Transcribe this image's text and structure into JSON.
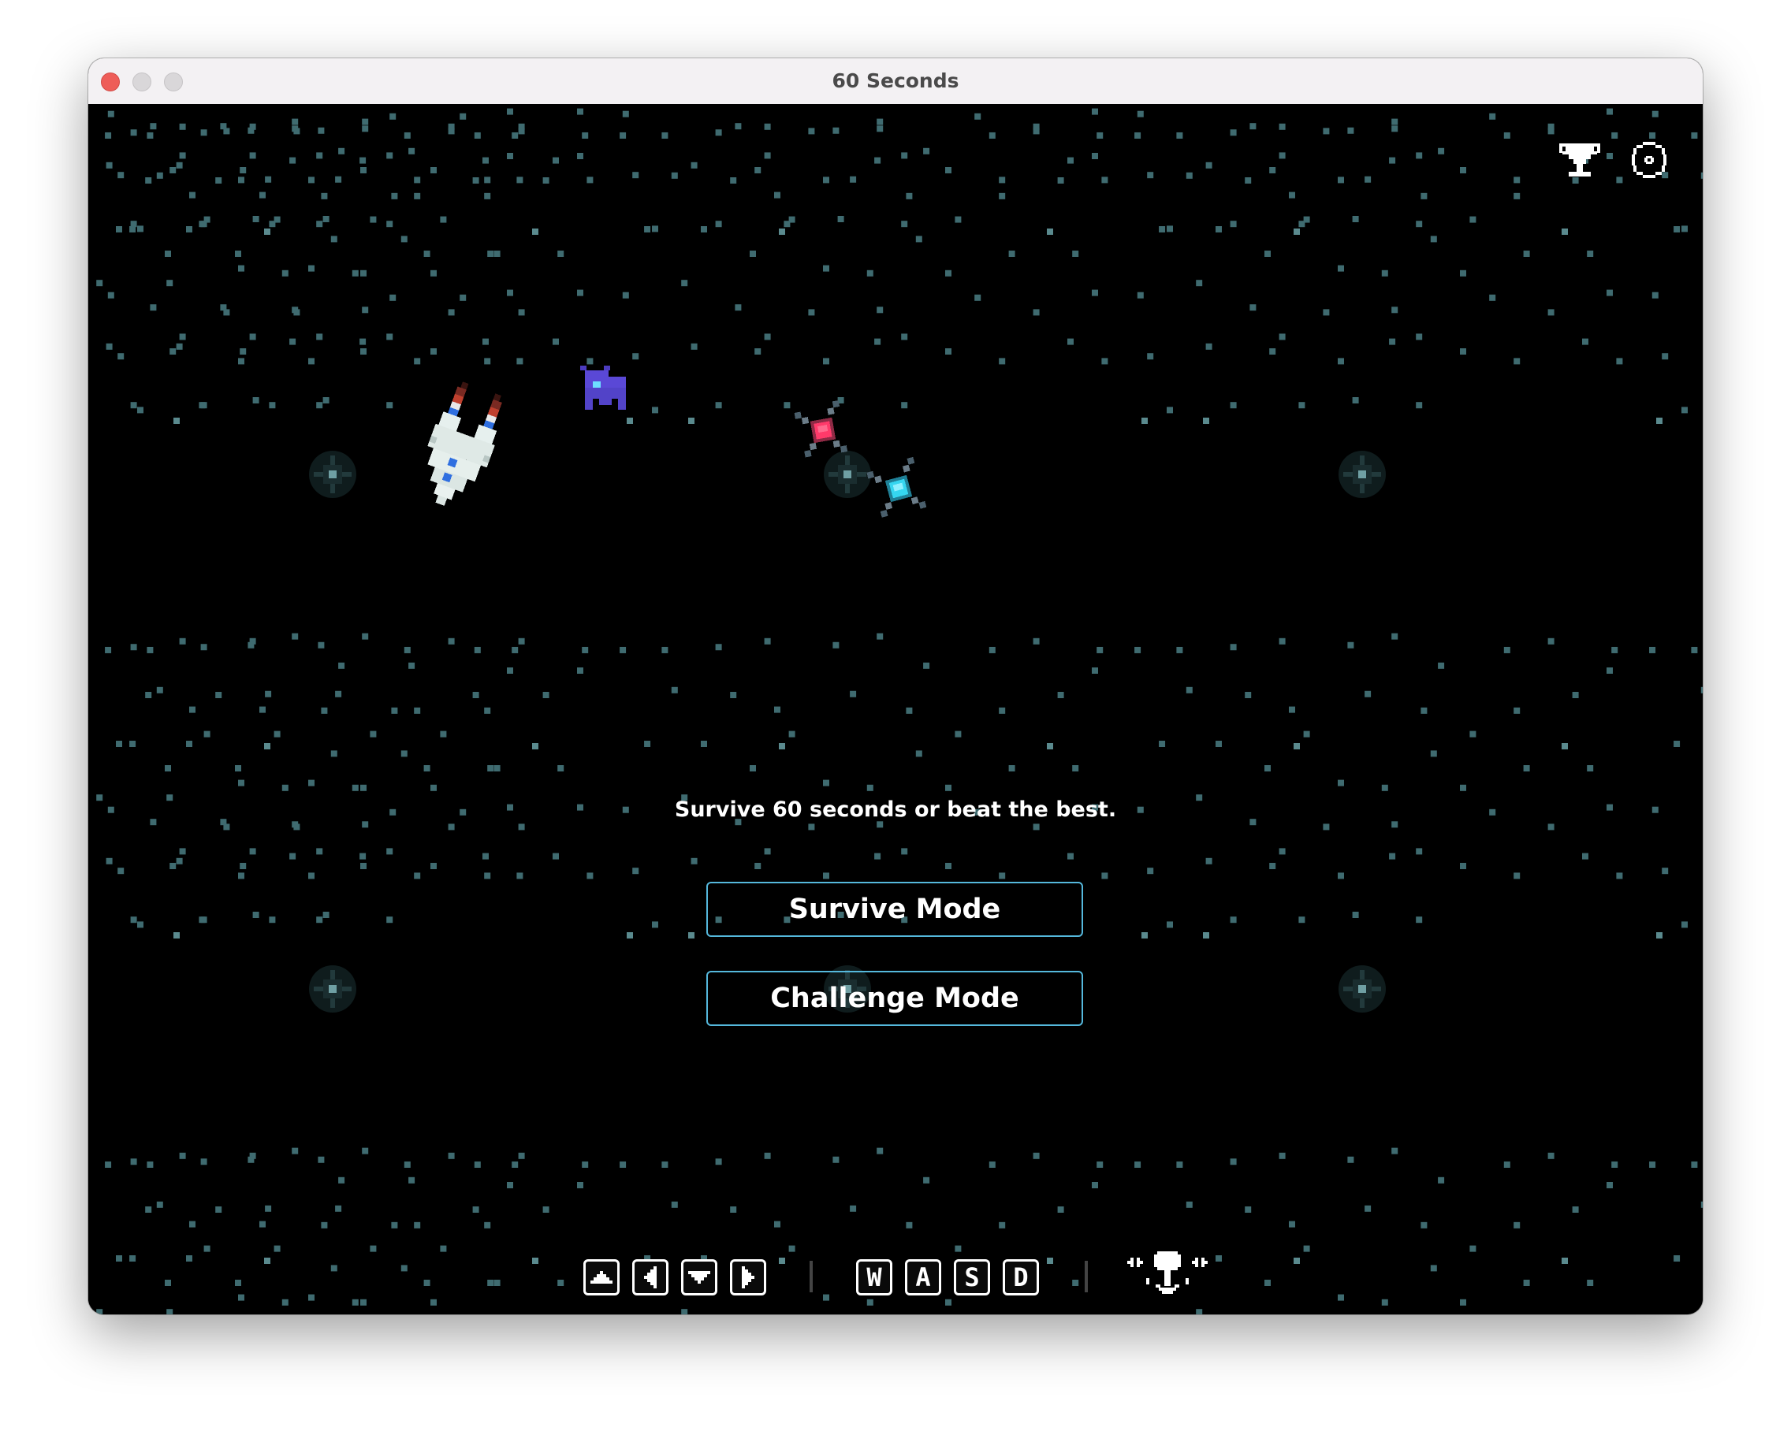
{
  "window": {
    "title": "60 Seconds"
  },
  "game": {
    "tagline": "Survive 60 seconds or beat the best.",
    "modes": {
      "survive_label": "Survive Mode",
      "challenge_label": "Challenge Mode"
    },
    "controls": {
      "arrow_keys": [
        "up-arrow-icon",
        "left-arrow-icon",
        "down-arrow-icon",
        "right-arrow-icon"
      ],
      "letter_keys": [
        "W",
        "A",
        "S",
        "D"
      ],
      "gamepad": "gamepad-icon"
    },
    "top_icons": [
      "trophy-icon",
      "gear-icon"
    ],
    "colors": {
      "background": "#000000",
      "accent": "#55b8dc",
      "star": "#3f6b70",
      "text": "#ffffff"
    }
  }
}
